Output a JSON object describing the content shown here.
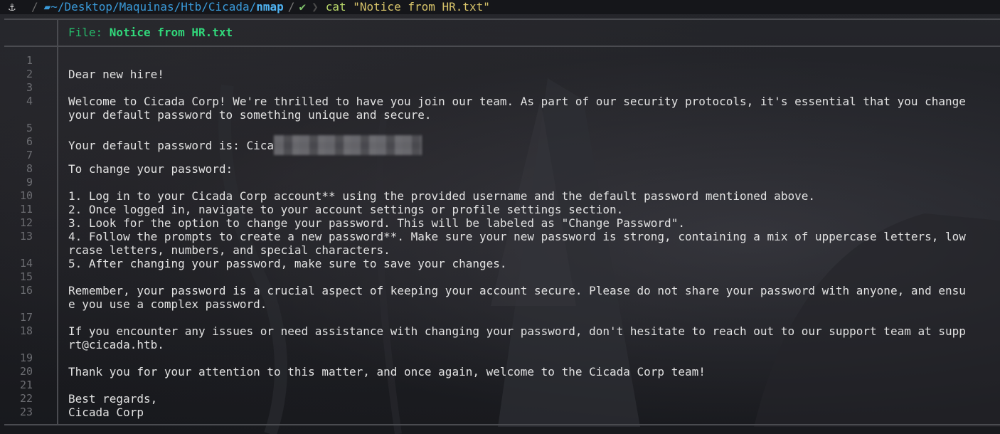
{
  "prompt": {
    "logo_icon": "kali-dragon-icon",
    "separator": "/",
    "folder_icon": "folder-open-icon",
    "path_prefix": "~/Desktop/Maquinas/Htb/Cicada/",
    "path_current": "nmap",
    "path_separator": "/",
    "status_icon": "check-icon",
    "status_glyph": "✔",
    "command": "cat",
    "argument": "\"Notice from HR.txt\""
  },
  "viewer": {
    "header_label": "File: ",
    "file_name": "Notice from HR.txt",
    "line_numbers": [
      "1",
      "2",
      "3",
      "4",
      "",
      "5",
      "6",
      "7",
      "8",
      "9",
      "10",
      "11",
      "12",
      "13",
      "",
      "14",
      "15",
      "16",
      "",
      "17",
      "18",
      "",
      "19",
      "20",
      "21",
      "22",
      "23"
    ],
    "lines": [
      "",
      "Dear new hire!",
      "",
      "Welcome to Cicada Corp! We're thrilled to have you join our team. As part of our security protocols, it's essential that you change",
      "your default password to something unique and secure.",
      "",
      "Your default password is: Cica",
      "",
      "To change your password:",
      "",
      "1. Log in to your Cicada Corp account** using the provided username and the default password mentioned above.",
      "2. Once logged in, navigate to your account settings or profile settings section.",
      "3. Look for the option to change your password. This will be labeled as \"Change Password\".",
      "4. Follow the prompts to create a new password**. Make sure your new password is strong, containing a mix of uppercase letters, low",
      "rcase letters, numbers, and special characters.",
      "5. After changing your password, make sure to save your changes.",
      "",
      "Remember, your password is a crucial aspect of keeping your account secure. Please do not share your password with anyone, and ensu",
      "e you use a complex password.",
      "",
      "If you encounter any issues or need assistance with changing your password, don't hesitate to reach out to our support team at supp",
      "rt@cicada.htb.",
      "",
      "Thank you for your attention to this matter, and once again, welcome to the Cicada Corp team!",
      "",
      "Best regards,",
      "Cicada Corp"
    ]
  },
  "colors": {
    "header_green": "#26b96a",
    "path_blue": "#3a9ad9",
    "command_green": "#b9d86a",
    "argument_yellow": "#d8c46a",
    "frame_gray": "#4a4b50"
  }
}
